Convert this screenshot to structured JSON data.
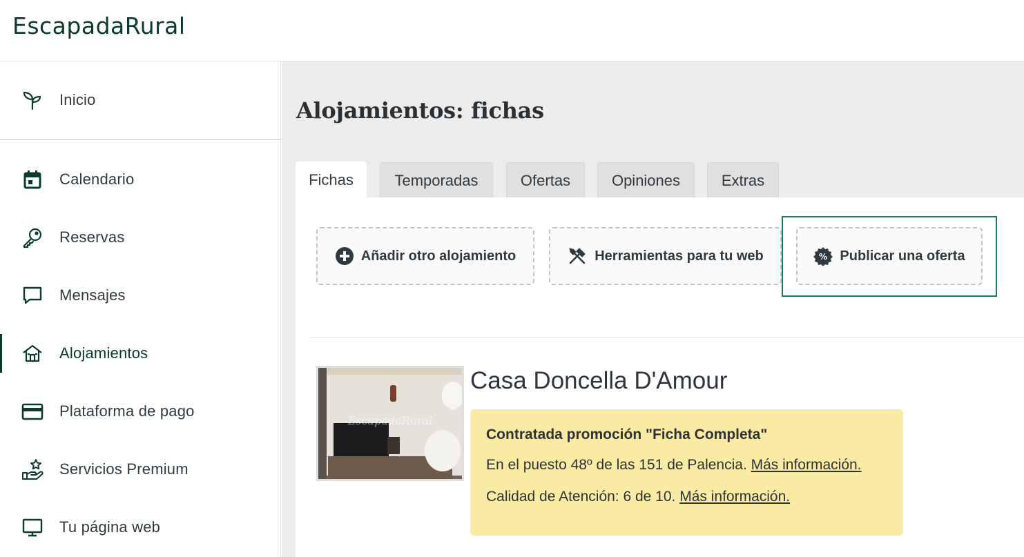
{
  "app": {
    "logo": "EscapadaRural"
  },
  "sidebar": {
    "items": [
      {
        "label": "Inicio",
        "icon": "sprout-icon"
      },
      {
        "label": "Calendario",
        "icon": "calendar-icon"
      },
      {
        "label": "Reservas",
        "icon": "key-icon"
      },
      {
        "label": "Mensajes",
        "icon": "message-icon"
      },
      {
        "label": "Alojamientos",
        "icon": "house-icon",
        "active": true
      },
      {
        "label": "Plataforma de pago",
        "icon": "credit-card-icon"
      },
      {
        "label": "Servicios Premium",
        "icon": "hand-star-icon"
      },
      {
        "label": "Tu página web",
        "icon": "monitor-icon"
      }
    ]
  },
  "main": {
    "title": "Alojamientos: fichas",
    "tabs": [
      {
        "label": "Fichas",
        "active": true
      },
      {
        "label": "Temporadas"
      },
      {
        "label": "Ofertas"
      },
      {
        "label": "Opiniones"
      },
      {
        "label": "Extras"
      }
    ],
    "actions": [
      {
        "label": "Añadir otro alojamiento",
        "icon": "plus-circle-icon"
      },
      {
        "label": "Herramientas para tu web",
        "icon": "tools-icon"
      },
      {
        "label": "Publicar una oferta",
        "icon": "percent-badge-icon",
        "highlighted": true
      }
    ],
    "listing": {
      "name": "Casa Doncella D'Amour",
      "photo_watermark": "EscapadaRural",
      "promo_title": "Contratada promoción \"Ficha Completa\"",
      "ranking_text": "En el puesto 48º de las 151 de Palencia.",
      "ranking_link": "Más información.",
      "quality_text": "Calidad de Atención: 6 de 10.",
      "quality_link": "Más información."
    }
  },
  "colors": {
    "brand": "#0b3b2b",
    "highlight": "#1b7f58",
    "promo_bg": "#f9eba3",
    "main_bg": "#ececec"
  }
}
